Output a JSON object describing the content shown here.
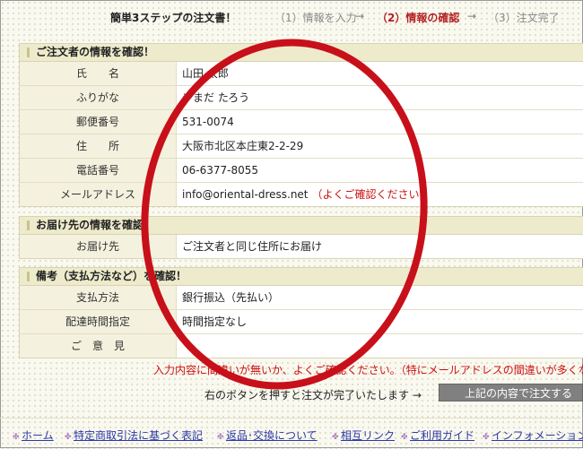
{
  "steps": {
    "title": "簡単3ステップの注文書！",
    "step1": "（1）情報を入力",
    "arrow": "→",
    "step2": "（2）情報の確認",
    "step3": "（3）注文完了"
  },
  "orderer": {
    "heading": "ご注文者の情報を確認！",
    "rows": [
      {
        "label": "氏　　名",
        "value": "山田 太郎"
      },
      {
        "label": "ふりがな",
        "value": "やまだ たろう"
      },
      {
        "label": "郵便番号",
        "value": "531-0074"
      },
      {
        "label": "住　　所",
        "value": "大阪市北区本庄東2-2-29"
      },
      {
        "label": "電話番号",
        "value": "06-6377-8055"
      },
      {
        "label": "メールアドレス",
        "value": "info@oriental-dress.net",
        "note": "（よくご確認ください）"
      }
    ]
  },
  "delivery": {
    "heading": "お届け先の情報を確認！",
    "rows": [
      {
        "label": "お届け先",
        "value": "ご注文者と同じ住所にお届け"
      }
    ]
  },
  "remarks": {
    "heading": "備考（支払方法など）を確認！",
    "rows": [
      {
        "label": "支払方法",
        "value": "銀行振込（先払い）"
      },
      {
        "label": "配達時間指定",
        "value": "時間指定なし"
      },
      {
        "label": "ご　意　見",
        "value": ""
      }
    ]
  },
  "notice": "入力内容に間違いが無いか、よくご確認ください。（特にメールアドレスの間違いが多くな",
  "submit": {
    "text": "右のボタンを押すと注文が完了いたします →",
    "button": "上記の内容で注文する"
  },
  "footer": {
    "links": [
      "ホーム",
      "特定商取引法に基づく表記",
      "返品･交換について",
      "相互リンク",
      "ご利用ガイド",
      "インフォメーション"
    ],
    "bullet_icon": "sparkle-icon"
  },
  "colors": {
    "accent_red": "#c8101a",
    "section_header": "#eeebcc",
    "label_bg": "#f4f2de",
    "link": "#2a38a8"
  }
}
